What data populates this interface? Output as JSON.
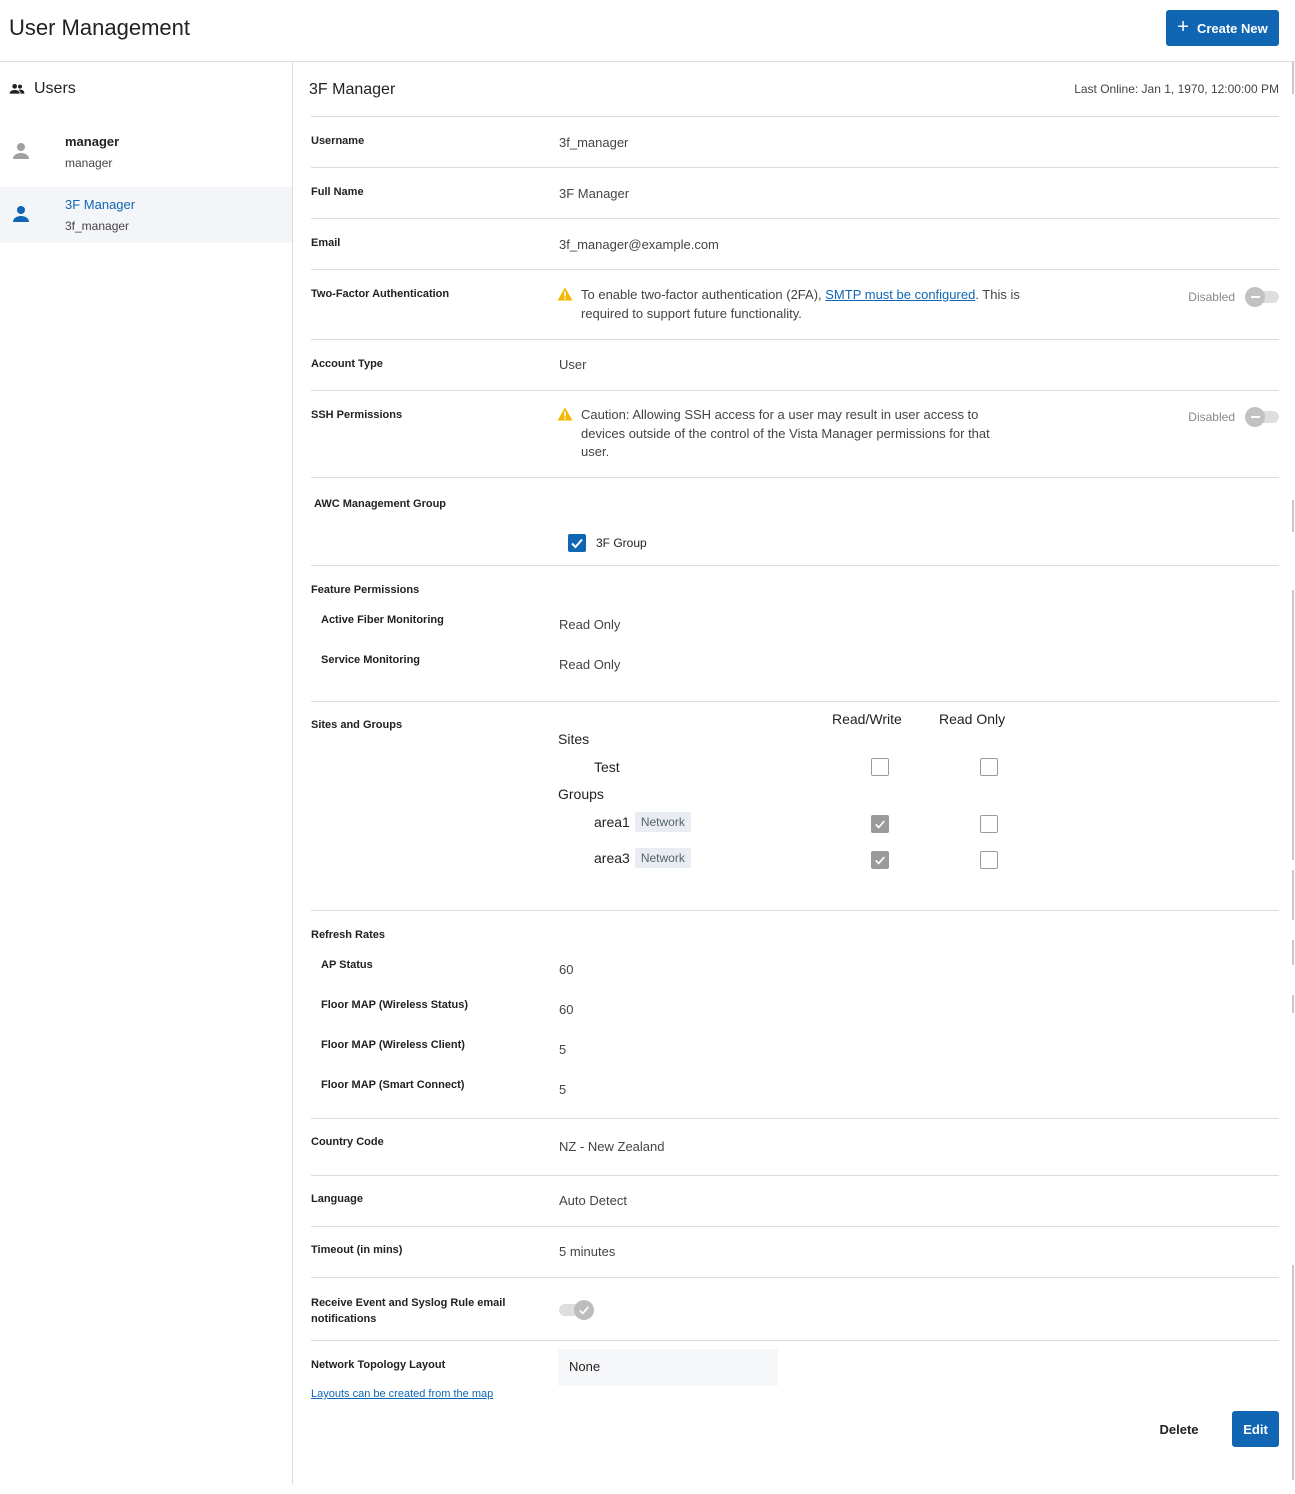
{
  "header": {
    "title": "User Management",
    "create_label": "Create New"
  },
  "sidebar": {
    "heading": "Users",
    "users": [
      {
        "name": "manager",
        "login": "manager"
      },
      {
        "name": "3F Manager",
        "login": "3f_manager"
      }
    ]
  },
  "detail": {
    "title": "3F Manager",
    "last_online": "Last Online: Jan 1, 1970, 12:00:00 PM",
    "username_label": "Username",
    "username": "3f_manager",
    "fullname_label": "Full Name",
    "fullname": "3F Manager",
    "email_label": "Email",
    "email": "3f_manager@example.com",
    "twofa": {
      "label": "Two-Factor Authentication",
      "text_before": "To enable two-factor authentication (2FA), ",
      "link": "SMTP must be configured",
      "text_after": ". This is required to support future functionality.",
      "status": "Disabled"
    },
    "account_type_label": "Account Type",
    "account_type": "User",
    "ssh": {
      "label": "SSH Permissions",
      "text": "Caution: Allowing SSH access for a user may result in user access to devices outside of the control of the Vista Manager permissions for that user.",
      "status": "Disabled"
    },
    "awc": {
      "label": "AWC Management Group",
      "group": "3F Group"
    },
    "features": {
      "label": "Feature Permissions",
      "items": [
        {
          "name": "Active Fiber Monitoring",
          "value": "Read Only"
        },
        {
          "name": "Service Monitoring",
          "value": "Read Only"
        }
      ]
    },
    "sites_groups": {
      "label": "Sites and Groups",
      "col_rw": "Read/Write",
      "col_ro": "Read Only",
      "sites_heading": "Sites",
      "sites": [
        {
          "name": "Test",
          "read_write": false,
          "read_only": false
        }
      ],
      "groups_heading": "Groups",
      "groups": [
        {
          "name": "area1",
          "tag": "Network",
          "read_write": true,
          "read_only": false
        },
        {
          "name": "area3",
          "tag": "Network",
          "read_write": true,
          "read_only": false
        }
      ]
    },
    "refresh": {
      "label": "Refresh Rates",
      "items": [
        {
          "name": "AP Status",
          "value": "60"
        },
        {
          "name": "Floor MAP (Wireless Status)",
          "value": "60"
        },
        {
          "name": "Floor MAP (Wireless Client)",
          "value": "5"
        },
        {
          "name": "Floor MAP (Smart Connect)",
          "value": "5"
        }
      ]
    },
    "country_label": "Country Code",
    "country": "NZ - New Zealand",
    "language_label": "Language",
    "language": "Auto Detect",
    "timeout_label": "Timeout (in mins)",
    "timeout": "5 minutes",
    "notifications_label": "Receive Event and Syslog Rule email notifications",
    "notifications_enabled": true,
    "topology_label": "Network Topology Layout",
    "topology_value": "None",
    "topology_link": "Layouts can be created from the map",
    "delete_label": "Delete",
    "edit_label": "Edit"
  },
  "colors": {
    "accent": "#1166b4",
    "warning": "#f5b800"
  }
}
